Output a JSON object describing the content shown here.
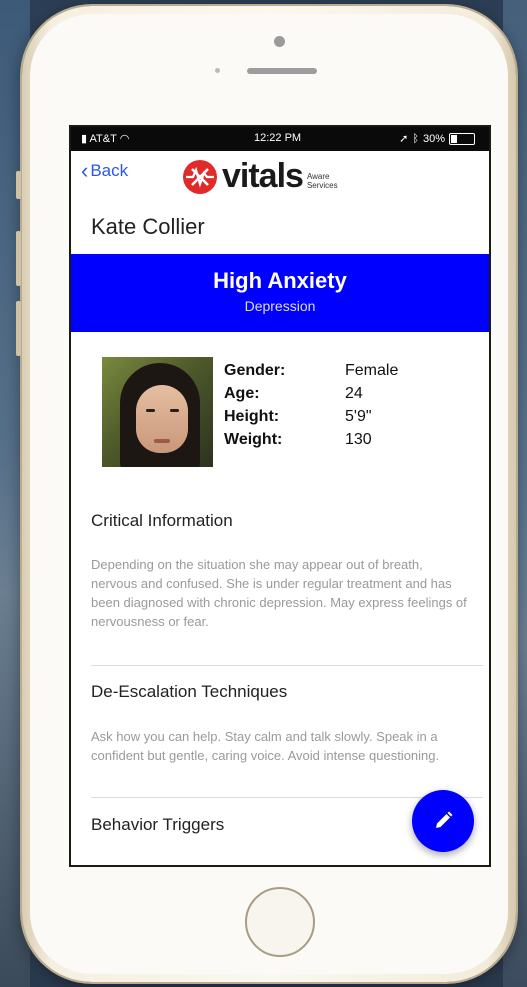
{
  "status_bar": {
    "carrier": "AT&T",
    "time": "12:22 PM",
    "battery": "30%",
    "battery_level": 0.3
  },
  "nav": {
    "back_label": "Back",
    "logo_word": "vitals",
    "logo_tagline_1": "Aware",
    "logo_tagline_2": "Services",
    "brand_color": "#e02b2b"
  },
  "patient": {
    "name": "Kate Collier",
    "condition": "High Anxiety",
    "sub_condition": "Depression",
    "details": [
      {
        "label": "Gender:",
        "value": "Female"
      },
      {
        "label": "Age:",
        "value": "24"
      },
      {
        "label": "Height:",
        "value": "5'9\""
      },
      {
        "label": "Weight:",
        "value": "130"
      }
    ]
  },
  "sections": [
    {
      "title": "Critical Information",
      "text": "Depending on the situation she may appear out of breath, nervous and confused. She is under regular treatment and has been diagnosed with chronic depression. May express feelings of nervousness or fear."
    },
    {
      "title": "De-Escalation Techniques",
      "text": "Ask how you can help. Stay calm and talk slowly. Speak in a confident but gentle, caring voice. Avoid intense questioning."
    },
    {
      "title": "Behavior Triggers",
      "text": ""
    }
  ],
  "colors": {
    "accent": "#0000ff",
    "link": "#2b58e8"
  },
  "icons": {
    "fab": "pencil-icon",
    "back": "chevron-left-icon"
  }
}
